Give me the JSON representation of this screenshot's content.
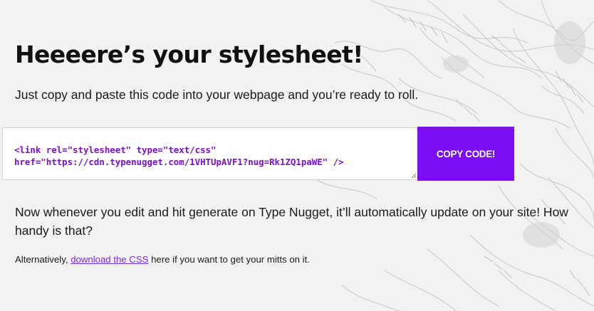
{
  "page": {
    "title": "Heeeere’s your stylesheet!",
    "intro": "Just copy and paste this code into your webpage and you’re ready to roll."
  },
  "code_snippet": {
    "line1": "<link rel=\"stylesheet\" type=\"text/css\"",
    "line2": "href=\"https://cdn.typenugget.com/1VHTUpAVF1?nug=Rk1ZQ1paWE\" />"
  },
  "copy_button": {
    "label": "COPY CODE!"
  },
  "update_note": {
    "text": "Now whenever you edit and hit generate on Type Nugget, it’ll automatically update on your site! How handy is that?"
  },
  "alternative": {
    "prefix": "Alternatively, ",
    "link_label": "download the CSS",
    "suffix": " here if you want to get your mitts on it."
  },
  "colors": {
    "accent": "#7b0ef5",
    "code_text": "#7a11ce",
    "link": "#7a2ad8",
    "background": "#f3f2f2"
  }
}
